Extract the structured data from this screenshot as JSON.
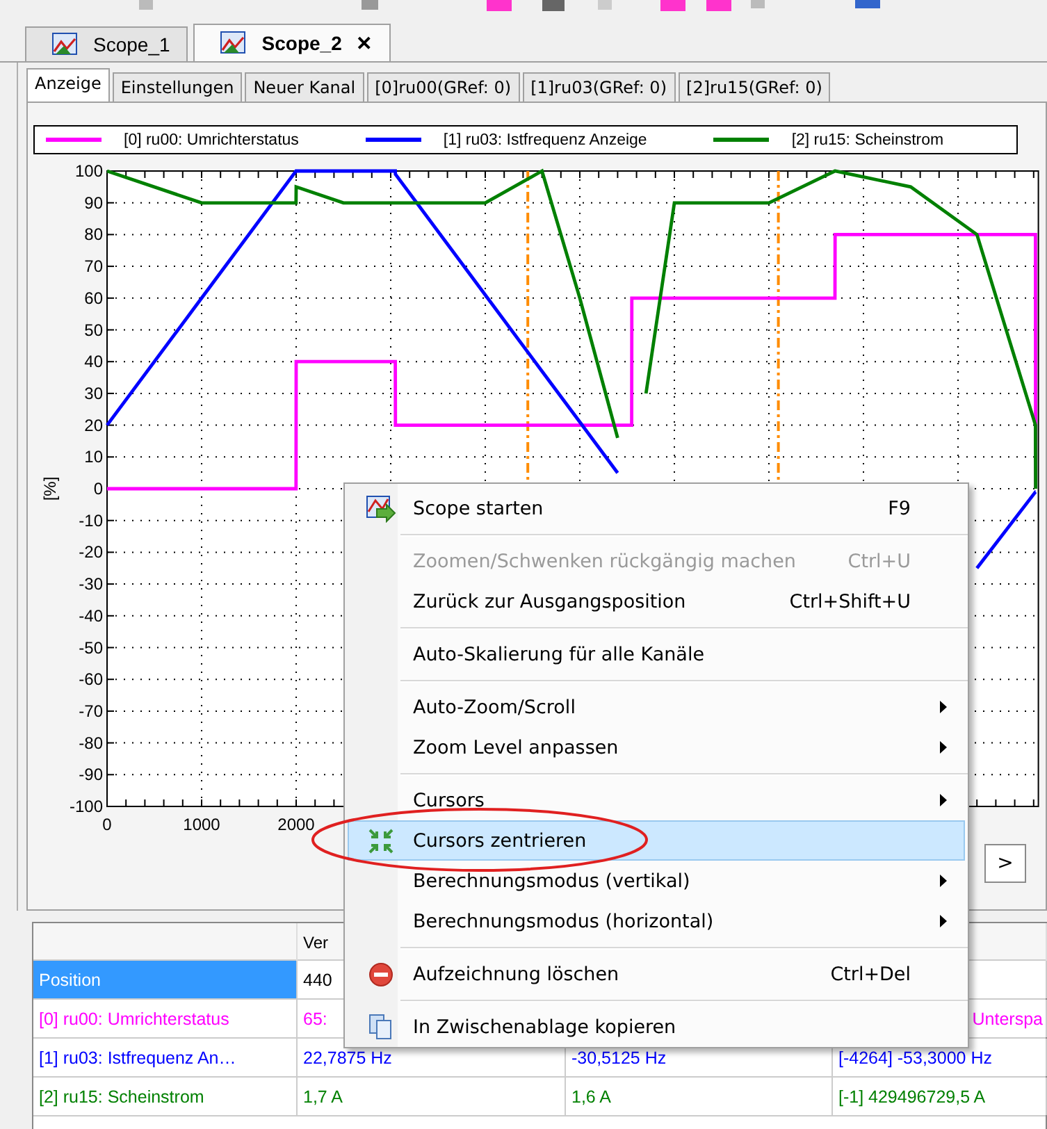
{
  "document_tabs": [
    {
      "label": "Scope_1",
      "selected": false
    },
    {
      "label": "Scope_2",
      "selected": true,
      "close": "✕"
    }
  ],
  "view_tabs": [
    {
      "label": "Anzeige",
      "selected": true
    },
    {
      "label": "Einstellungen",
      "selected": false
    },
    {
      "label": "Neuer Kanal",
      "selected": false
    },
    {
      "label": "[0]ru00(GRef: 0)",
      "selected": false
    },
    {
      "label": "[1]ru03(GRef: 0)",
      "selected": false
    },
    {
      "label": "[2]ru15(GRef: 0)",
      "selected": false
    }
  ],
  "chart_data": {
    "type": "line",
    "ylabel": "[%]",
    "grid": true,
    "x": [
      0,
      1000,
      1999,
      2000,
      2500,
      3049,
      3050,
      4000,
      4600,
      5000,
      5400,
      5549,
      5550,
      5700,
      6000,
      7000,
      7699,
      7700,
      8500,
      9200,
      9819,
      9820
    ],
    "series": [
      {
        "name": "[0] ru00: Umrichterstatus",
        "color": "#ff00ff",
        "values": [
          0,
          0,
          0,
          40,
          40,
          40,
          20,
          20,
          20,
          20,
          20,
          20,
          60,
          60,
          60,
          60,
          60,
          80,
          80,
          80,
          80,
          0
        ]
      },
      {
        "name": "[1] ru03: Istfrequenz Anzeige",
        "color": "#0000ff",
        "values": [
          20,
          60,
          100,
          100,
          100,
          100,
          99,
          61,
          37,
          21,
          5,
          null,
          null,
          null,
          null,
          null,
          null,
          null,
          null,
          -25,
          -1,
          -1
        ]
      },
      {
        "name": "[2] ru15: Scheinstrom",
        "color": "#008000",
        "values": [
          100,
          90,
          90,
          95,
          90,
          90,
          90,
          90,
          100,
          60,
          16,
          null,
          null,
          30,
          90,
          90,
          100,
          100,
          95,
          80,
          20,
          0
        ]
      }
    ],
    "xlim": [
      0,
      9850
    ],
    "ylim": [
      -100,
      100
    ],
    "xticks": [
      0,
      1000,
      2000
    ],
    "yticks": [
      -100,
      -90,
      -80,
      -70,
      -60,
      -50,
      -40,
      -30,
      -20,
      -10,
      0,
      10,
      20,
      30,
      40,
      50,
      60,
      70,
      80,
      90,
      100
    ],
    "ref_lines": [
      {
        "axis": "x",
        "value": 4450,
        "color": "#ff8c00"
      },
      {
        "axis": "x",
        "value": 7100,
        "color": "#ff8c00"
      }
    ]
  },
  "scroll_right": ">",
  "table": {
    "column_2_header": "Ver",
    "rows": [
      {
        "label": "Position",
        "selected": true,
        "color": "#000000",
        "cells": [
          "440",
          null,
          null
        ]
      },
      {
        "label": "[0] ru00: Umrichterstatus",
        "selected": false,
        "color": "#ff00ff",
        "cells": [
          "65:",
          null,
          "Unterspa"
        ]
      },
      {
        "label": "[1] ru03: Istfrequenz An…",
        "selected": false,
        "color": "#0000ff",
        "cells": [
          "22,7875 Hz",
          "-30,5125 Hz",
          "[-4264] -53,3000 Hz"
        ]
      },
      {
        "label": "[2] ru15: Scheinstrom",
        "selected": false,
        "color": "#008000",
        "cells": [
          "1,7 A",
          "1,6 A",
          "[-1] 429496729,5 A"
        ]
      }
    ]
  },
  "context_menu": [
    {
      "kind": "item",
      "label": "Scope starten",
      "shortcut": "F9",
      "submenu": false,
      "disabled": false,
      "selected": false
    },
    {
      "kind": "separator"
    },
    {
      "kind": "item",
      "label": "Zoomen/Schwenken rückgängig machen",
      "shortcut": "Ctrl+U",
      "submenu": false,
      "disabled": true,
      "selected": false
    },
    {
      "kind": "item",
      "label": "Zurück zur Ausgangsposition",
      "shortcut": "Ctrl+Shift+U",
      "submenu": false,
      "disabled": false,
      "selected": false
    },
    {
      "kind": "separator"
    },
    {
      "kind": "item",
      "label": "Auto-Skalierung für alle Kanäle",
      "submenu": false,
      "disabled": false,
      "selected": false
    },
    {
      "kind": "separator"
    },
    {
      "kind": "item",
      "label": "Auto-Zoom/Scroll",
      "submenu": true,
      "disabled": false,
      "selected": false
    },
    {
      "kind": "item",
      "label": "Zoom Level anpassen",
      "submenu": true,
      "disabled": false,
      "selected": false
    },
    {
      "kind": "separator"
    },
    {
      "kind": "item",
      "label": "Cursors",
      "submenu": true,
      "disabled": false,
      "selected": false
    },
    {
      "kind": "item",
      "label": "Cursors zentrieren",
      "submenu": false,
      "disabled": false,
      "selected": true
    },
    {
      "kind": "item",
      "label": "Berechnungsmodus (vertikal)",
      "submenu": true,
      "disabled": false,
      "selected": false
    },
    {
      "kind": "item",
      "label": "Berechnungsmodus (horizontal)",
      "submenu": true,
      "disabled": false,
      "selected": false
    },
    {
      "kind": "separator"
    },
    {
      "kind": "item",
      "label": "Aufzeichnung löschen",
      "shortcut": "Ctrl+Del",
      "submenu": false,
      "disabled": false,
      "selected": false
    },
    {
      "kind": "separator"
    },
    {
      "kind": "item",
      "label": "In Zwischenablage kopieren",
      "submenu": false,
      "disabled": false,
      "selected": false
    }
  ]
}
